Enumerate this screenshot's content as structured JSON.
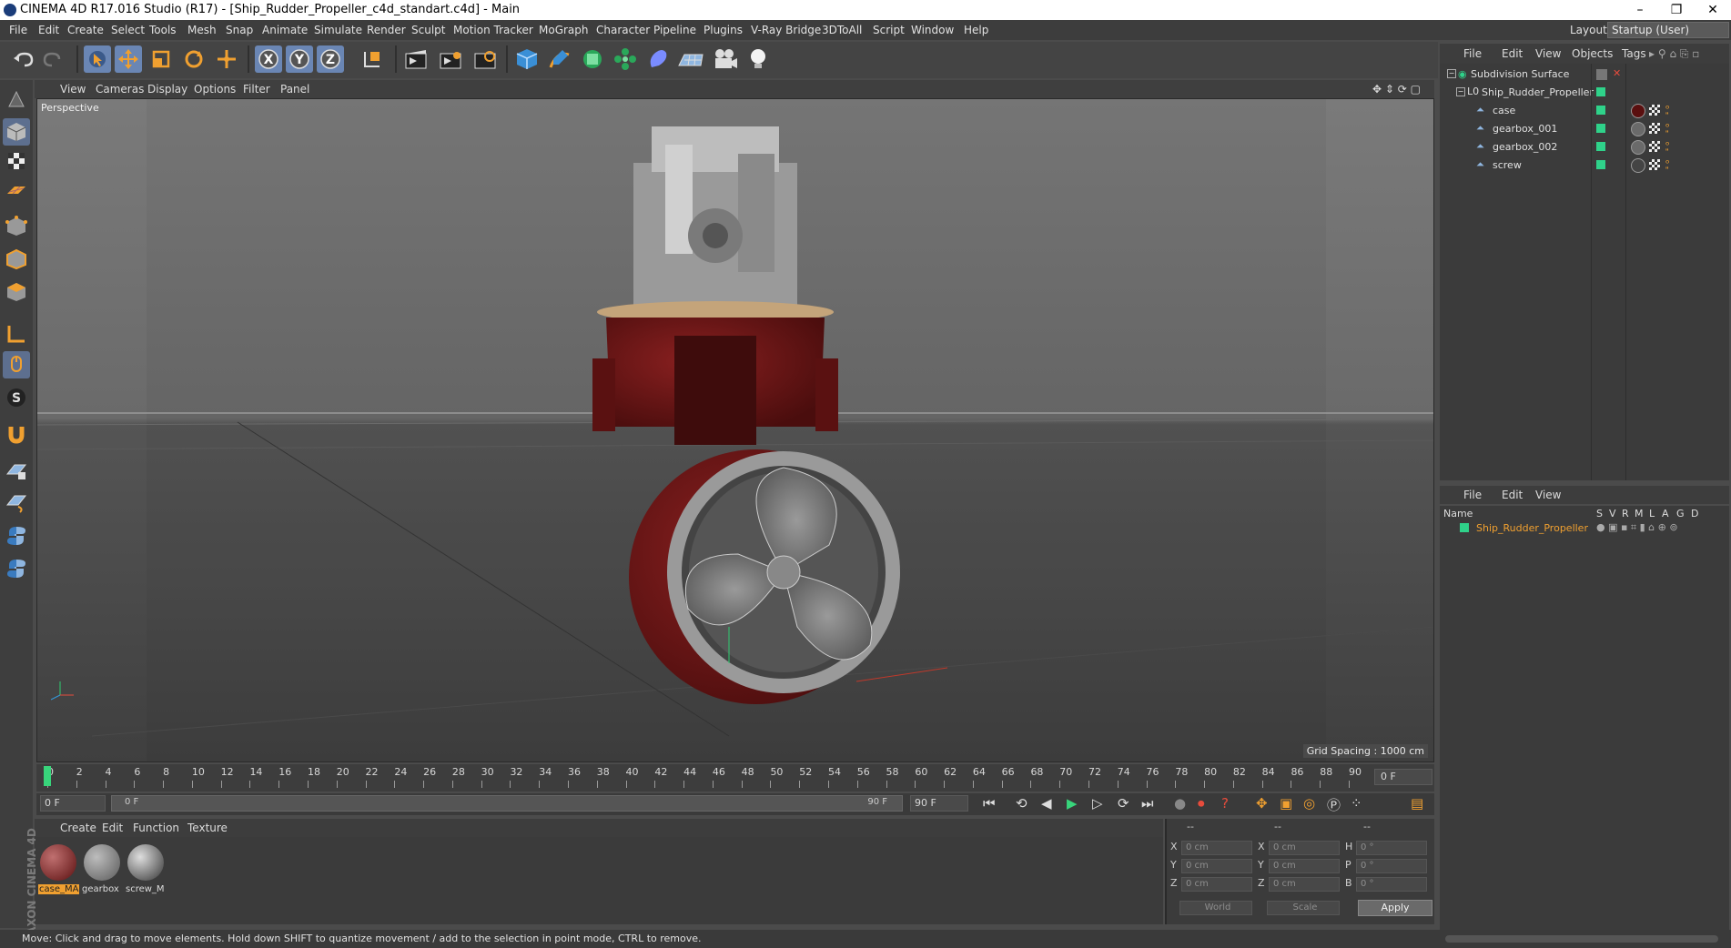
{
  "window": {
    "title": "CINEMA 4D R17.016 Studio (R17) - [Ship_Rudder_Propeller_c4d_standart.c4d] - Main",
    "controls": {
      "minimize": "–",
      "restore": "❐",
      "close": "✕"
    }
  },
  "menubar": {
    "items": [
      "File",
      "Edit",
      "Create",
      "Select",
      "Tools",
      "Mesh",
      "Snap",
      "Animate",
      "Simulate",
      "Render",
      "Sculpt",
      "Motion Tracker",
      "MoGraph",
      "Character",
      "Pipeline",
      "Plugins",
      "V-Ray Bridge",
      "3DToAll",
      "Script",
      "Window",
      "Help"
    ],
    "layout_label": "Layout:",
    "layout_value": "Startup (User)"
  },
  "toolbar": {
    "icons": [
      "undo-icon",
      "redo-icon",
      "select-arrow-icon",
      "move-icon",
      "scale-icon",
      "rotate-icon",
      "transform-icon",
      "x-axis-icon",
      "y-axis-icon",
      "z-axis-icon",
      "coordinate-system-icon",
      "render-view-icon",
      "render-picture-viewer-icon",
      "render-settings-icon",
      "cube-primitive-icon",
      "spline-pen-icon",
      "nurbs-icon",
      "array-icon",
      "deformer-icon",
      "floor-icon",
      "camera-icon",
      "light-icon"
    ]
  },
  "viewport": {
    "menu": [
      "View",
      "Cameras",
      "Display",
      "Options",
      "Filter",
      "Panel"
    ],
    "label": "Perspective",
    "grid_spacing": "Grid Spacing : 1000 cm"
  },
  "timeline": {
    "ticks": [
      "0",
      "2",
      "4",
      "6",
      "8",
      "10",
      "12",
      "14",
      "16",
      "18",
      "20",
      "22",
      "24",
      "26",
      "28",
      "30",
      "32",
      "34",
      "36",
      "38",
      "40",
      "42",
      "44",
      "46",
      "48",
      "50",
      "52",
      "54",
      "56",
      "58",
      "60",
      "62",
      "64",
      "66",
      "68",
      "70",
      "72",
      "74",
      "76",
      "78",
      "80",
      "82",
      "84",
      "86",
      "88",
      "90"
    ],
    "current_frame": "0 F",
    "start_field": "0 F",
    "range_start": "0 F",
    "range_end": "90 F",
    "end_field": "90 F"
  },
  "material_manager": {
    "menu": [
      "Create",
      "Edit",
      "Function",
      "Texture"
    ],
    "materials": [
      {
        "name": "case_MA",
        "color": "#7a1a1a",
        "selected": true
      },
      {
        "name": "gearbox",
        "color": "#8a8a8a",
        "selected": false
      },
      {
        "name": "screw_M",
        "color": "#6a6a6a",
        "selected": false
      }
    ]
  },
  "coordinates": {
    "headers": [
      "--",
      "--",
      "--"
    ],
    "rows": [
      {
        "a": "X",
        "av": "0 cm",
        "b": "X",
        "bv": "0 cm",
        "c": "H",
        "cv": "0 °"
      },
      {
        "a": "Y",
        "av": "0 cm",
        "b": "Y",
        "bv": "0 cm",
        "c": "P",
        "cv": "0 °"
      },
      {
        "a": "Z",
        "av": "0 cm",
        "b": "Z",
        "bv": "0 cm",
        "c": "B",
        "cv": "0 °"
      }
    ],
    "world": "World",
    "scale": "Scale",
    "apply": "Apply"
  },
  "object_manager": {
    "menu": [
      "File",
      "Edit",
      "View",
      "Objects",
      "Tags"
    ],
    "objects": [
      {
        "name": "Subdivision Surface",
        "indent": 0
      },
      {
        "name": "Ship_Rudder_Propeller",
        "indent": 1
      },
      {
        "name": "case",
        "indent": 2
      },
      {
        "name": "gearbox_001",
        "indent": 2
      },
      {
        "name": "gearbox_002",
        "indent": 2
      },
      {
        "name": "screw",
        "indent": 2
      }
    ]
  },
  "attribute_manager": {
    "menu": [
      "File",
      "Edit",
      "View"
    ],
    "col_name": "Name",
    "col_flags": [
      "S",
      "V",
      "R",
      "M",
      "L",
      "A",
      "G",
      "D"
    ],
    "layer_name": "Ship_Rudder_Propeller"
  },
  "status": "Move: Click and drag to move elements. Hold down SHIFT to quantize movement / add to the selection in point mode, CTRL to remove.",
  "brand": "MAXON CINEMA 4D",
  "colors": {
    "accent_orange": "#f0a030",
    "selected_blue": "#6a86b4",
    "green_tag": "#2fd28a",
    "propeller_red": "#6d1515"
  }
}
